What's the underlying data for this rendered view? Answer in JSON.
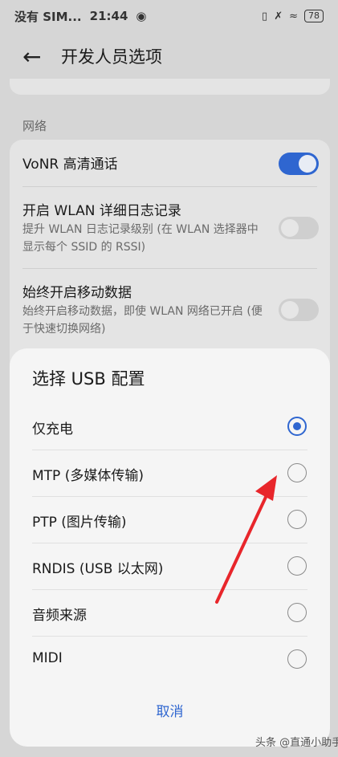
{
  "status_bar": {
    "carrier": "没有 SIM...",
    "time": "21:44",
    "battery": "78"
  },
  "header": {
    "title": "开发人员选项"
  },
  "section": {
    "label": "网络"
  },
  "settings": [
    {
      "title": "VoNR 高清通话",
      "subtitle": "",
      "toggle": "on"
    },
    {
      "title": "开启 WLAN 详细日志记录",
      "subtitle": "提升 WLAN 日志记录级别 (在 WLAN 选择器中显示每个 SSID 的 RSSI)",
      "toggle": "off"
    },
    {
      "title": "始终开启移动数据",
      "subtitle": "始终开启移动数据，即使 WLAN 网络已开启 (便于快速切换网络)",
      "toggle": "off"
    }
  ],
  "dialog": {
    "title": "选择 USB 配置",
    "options": [
      {
        "label": "仅充电",
        "selected": true
      },
      {
        "label": "MTP (多媒体传输)",
        "selected": false
      },
      {
        "label": "PTP (图片传输)",
        "selected": false
      },
      {
        "label": "RNDIS (USB 以太网)",
        "selected": false
      },
      {
        "label": "音频来源",
        "selected": false
      },
      {
        "label": "MIDI",
        "selected": false
      }
    ],
    "cancel_label": "取消"
  },
  "colors": {
    "accent": "#2f66d0",
    "annotation_arrow": "#e8262b"
  },
  "watermark": "头条 @直通小助手"
}
